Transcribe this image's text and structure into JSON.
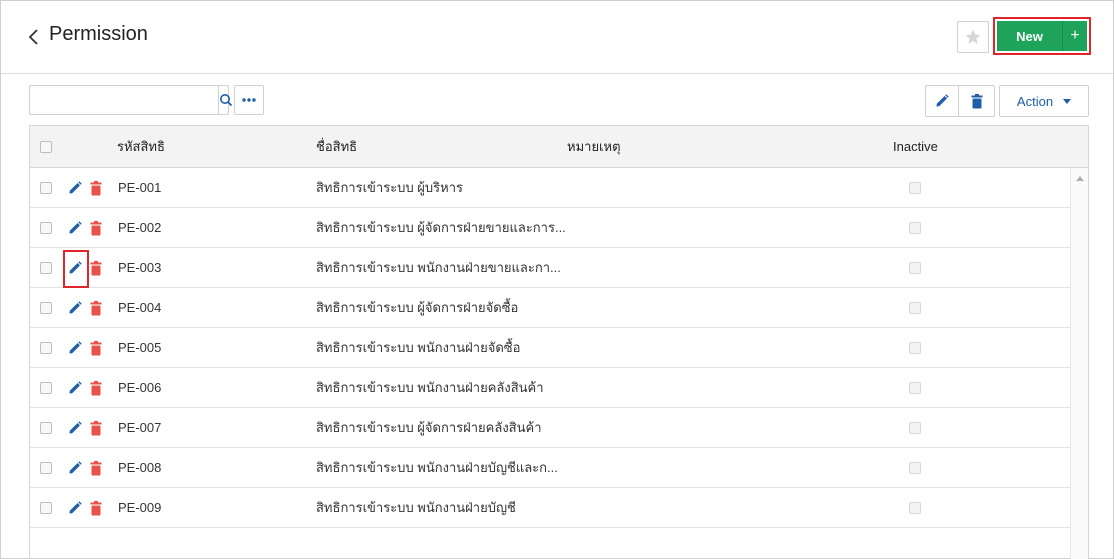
{
  "header": {
    "title": "Permission",
    "new_label": "New",
    "new_plus": "+"
  },
  "toolbar": {
    "search_placeholder": "",
    "action_label": "Action"
  },
  "table": {
    "columns": {
      "code": "รหัสสิทธิ",
      "name": "ชื่อสิทธิ",
      "remark": "หมายเหตุ",
      "inactive": "Inactive"
    },
    "rows": [
      {
        "code": "PE-001",
        "name": "สิทธิการเข้าระบบ ผู้บริหาร"
      },
      {
        "code": "PE-002",
        "name": "สิทธิการเข้าระบบ ผู้จัดการฝ่ายขายและการ..."
      },
      {
        "code": "PE-003",
        "name": "สิทธิการเข้าระบบ พนักงานฝ่ายขายและกา..."
      },
      {
        "code": "PE-004",
        "name": "สิทธิการเข้าระบบ ผู้จัดการฝ่ายจัดซื้อ"
      },
      {
        "code": "PE-005",
        "name": "สิทธิการเข้าระบบ พนักงานฝ่ายจัดซื้อ"
      },
      {
        "code": "PE-006",
        "name": "สิทธิการเข้าระบบ พนักงานฝ่ายคลังสินค้า"
      },
      {
        "code": "PE-007",
        "name": "สิทธิการเข้าระบบ ผู้จัดการฝ่ายคลังสินค้า"
      },
      {
        "code": "PE-008",
        "name": "สิทธิการเข้าระบบ พนักงานฝ่ายบัญชีและก..."
      },
      {
        "code": "PE-009",
        "name": "สิทธิการเข้าระบบ พนักงานฝ่ายบัญชี"
      }
    ]
  },
  "colors": {
    "primary_green": "#1ea35a",
    "edit_blue": "#1f5fa8",
    "delete_red": "#e8524a",
    "highlight_red": "#e0262d"
  },
  "icons": {
    "back": "chevron-left-icon",
    "favorite": "star-icon",
    "search": "search-icon",
    "more": "ellipsis-icon",
    "edit": "pencil-icon",
    "delete": "trash-icon"
  }
}
